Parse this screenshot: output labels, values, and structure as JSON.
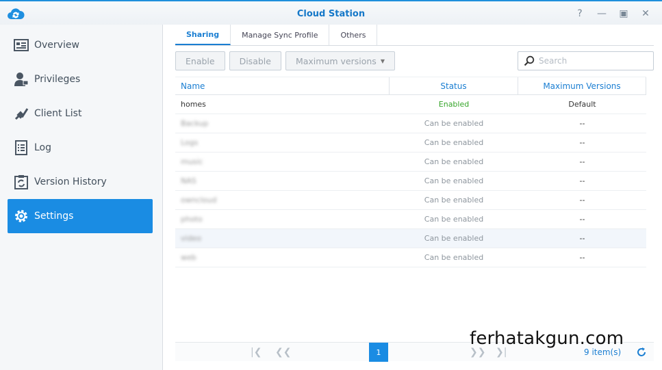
{
  "window": {
    "title": "Cloud Station"
  },
  "sidebar": {
    "items": [
      {
        "label": "Overview",
        "icon": "overview-icon"
      },
      {
        "label": "Privileges",
        "icon": "privileges-icon"
      },
      {
        "label": "Client List",
        "icon": "client-list-icon"
      },
      {
        "label": "Log",
        "icon": "log-icon"
      },
      {
        "label": "Version History",
        "icon": "version-history-icon"
      },
      {
        "label": "Settings",
        "icon": "settings-icon",
        "active": true
      }
    ]
  },
  "tabs": [
    {
      "label": "Sharing",
      "active": true
    },
    {
      "label": "Manage Sync Profile"
    },
    {
      "label": "Others"
    }
  ],
  "toolbar": {
    "enable_label": "Enable",
    "disable_label": "Disable",
    "max_versions_label": "Maximum versions"
  },
  "search": {
    "placeholder": "Search"
  },
  "table": {
    "headers": {
      "name": "Name",
      "status": "Status",
      "max_versions": "Maximum Versions"
    },
    "rows": [
      {
        "name": "homes",
        "status": "Enabled",
        "max_versions": "Default"
      },
      {
        "name": "Backup",
        "status": "Can be enabled",
        "max_versions": "--"
      },
      {
        "name": "Logs",
        "status": "Can be enabled",
        "max_versions": "--"
      },
      {
        "name": "music",
        "status": "Can be enabled",
        "max_versions": "--"
      },
      {
        "name": "NAS",
        "status": "Can be enabled",
        "max_versions": "--"
      },
      {
        "name": "owncloud",
        "status": "Can be enabled",
        "max_versions": "--"
      },
      {
        "name": "photo",
        "status": "Can be enabled",
        "max_versions": "--"
      },
      {
        "name": "video",
        "status": "Can be enabled",
        "max_versions": "--"
      },
      {
        "name": "web",
        "status": "Can be enabled",
        "max_versions": "--"
      }
    ]
  },
  "pager": {
    "current_page": "1",
    "item_count": "9 item(s)"
  },
  "watermark": "ferhatakgun.com",
  "colors": {
    "accent": "#1a8ce3",
    "enabled": "#36a52a"
  }
}
